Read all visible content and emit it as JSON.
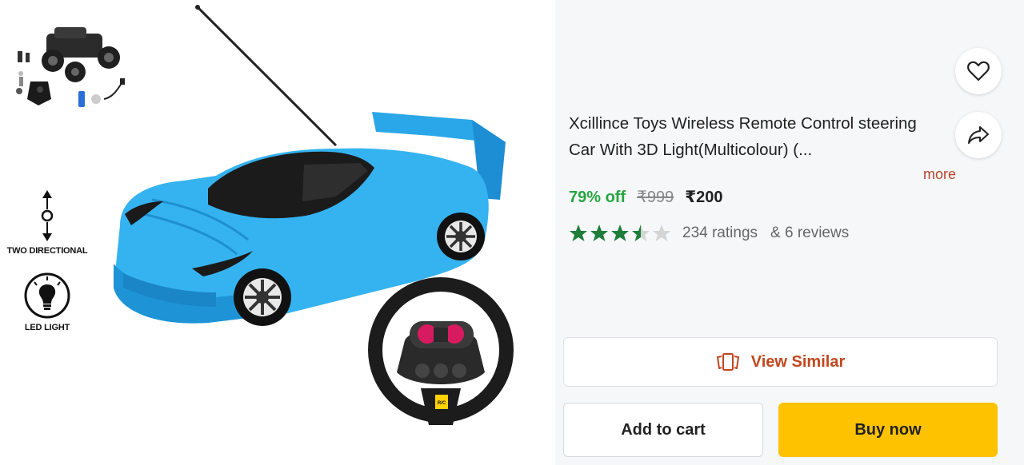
{
  "gallery": {
    "feature_two_directional": "TWO DIRECTIONAL",
    "feature_led_light": "LED LIGHT",
    "wheel_badge": "R/C"
  },
  "product": {
    "title": "Xcillince Toys Wireless Remote Control steering Car With 3D Light(Multicolour)  (...",
    "more_label": "more",
    "discount": "79% off",
    "mrp": "₹999",
    "price": "₹200",
    "rating_value": 3.5,
    "rating_max": 5,
    "ratings_count": "234 ratings",
    "reviews_count": "& 6 reviews"
  },
  "actions": {
    "view_similar": "View Similar",
    "add_to_cart": "Add to cart",
    "buy_now": "Buy now"
  },
  "icons": {
    "wishlist": "heart-icon",
    "share": "share-icon",
    "view_similar": "similar-cards-icon"
  },
  "colors": {
    "discount": "#26a541",
    "star": "#1e7e3a",
    "buy_now": "#ffc200",
    "view_similar_text": "#c2461d",
    "more_text": "#b5462a"
  }
}
